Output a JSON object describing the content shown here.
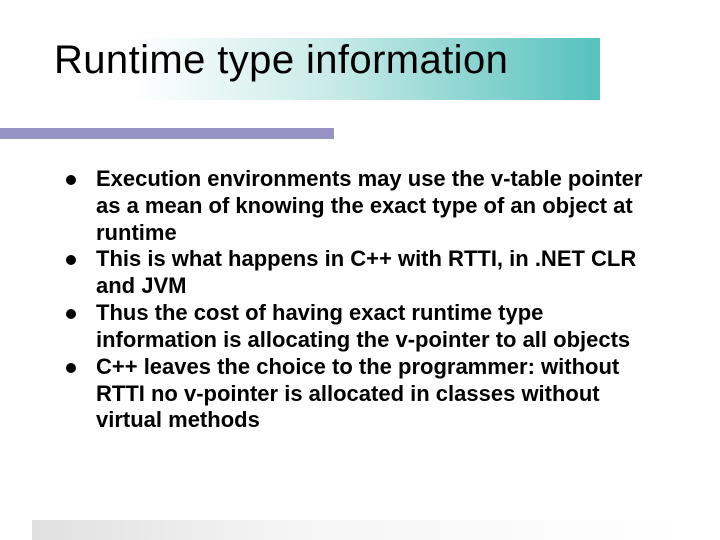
{
  "slide": {
    "title": "Runtime type information",
    "bullets": [
      "Execution environments may use the v-table pointer as a mean of knowing the exact type of an object at runtime",
      "This is what happens in C++ with RTTI, in .NET CLR and JVM",
      "Thus the cost of having exact runtime type information is allocating the v-pointer to all objects",
      "C++ leaves the choice to the programmer: without RTTI no v-pointer is allocated in classes without virtual methods"
    ]
  }
}
